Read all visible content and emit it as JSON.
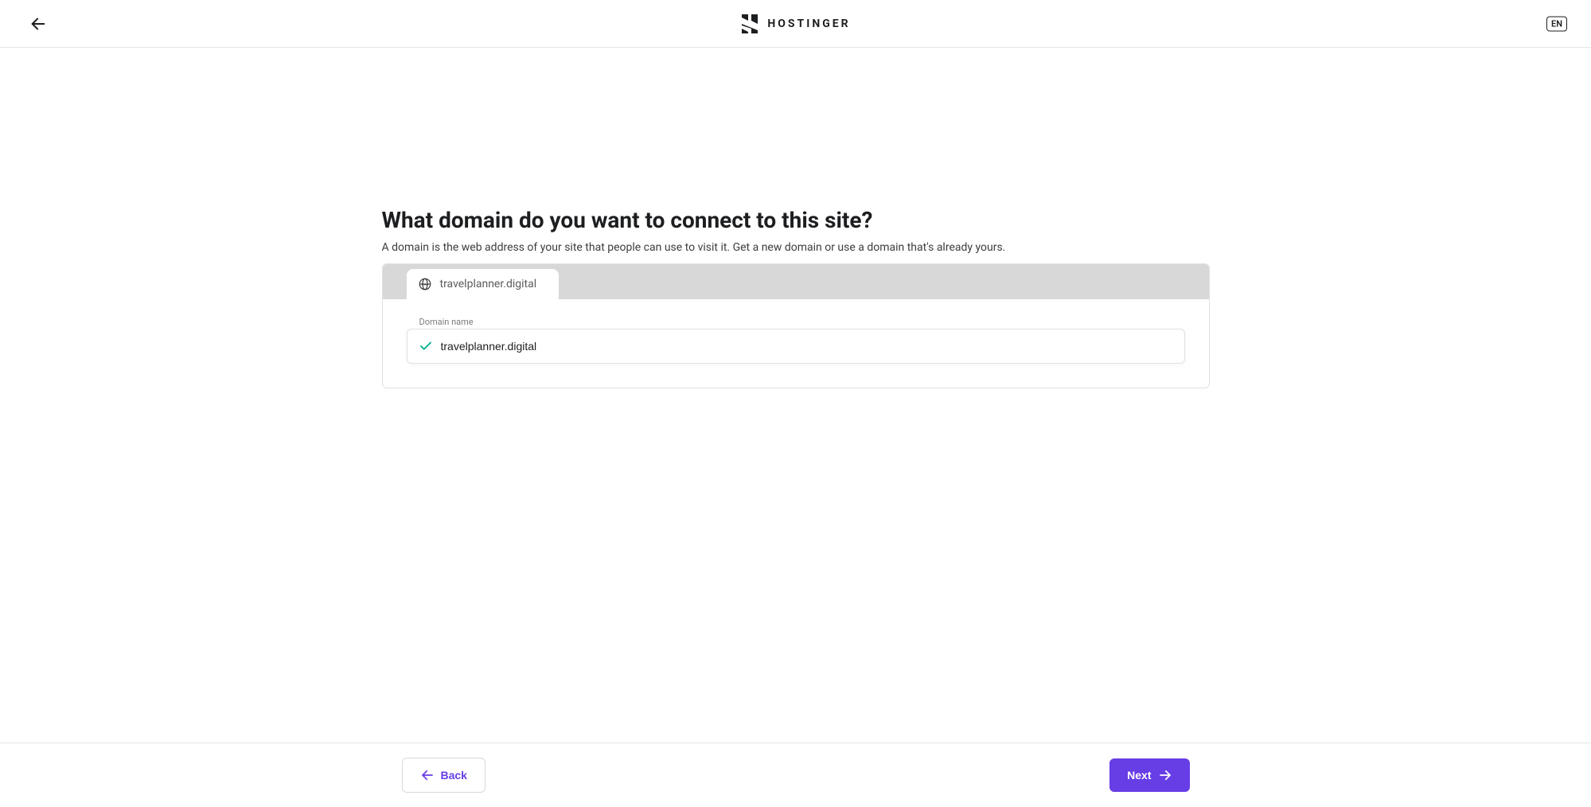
{
  "header": {
    "brand": "HOSTINGER",
    "lang": "EN"
  },
  "main": {
    "title": "What domain do you want to connect to this site?",
    "subtitle": "A domain is the web address of your site that people can use to visit it. Get a new domain or use a domain that's already yours.",
    "tab": {
      "label": "travelplanner.digital"
    },
    "field": {
      "label": "Domain name",
      "value": "travelplanner.digital"
    }
  },
  "footer": {
    "back_label": "Back",
    "next_label": "Next"
  }
}
